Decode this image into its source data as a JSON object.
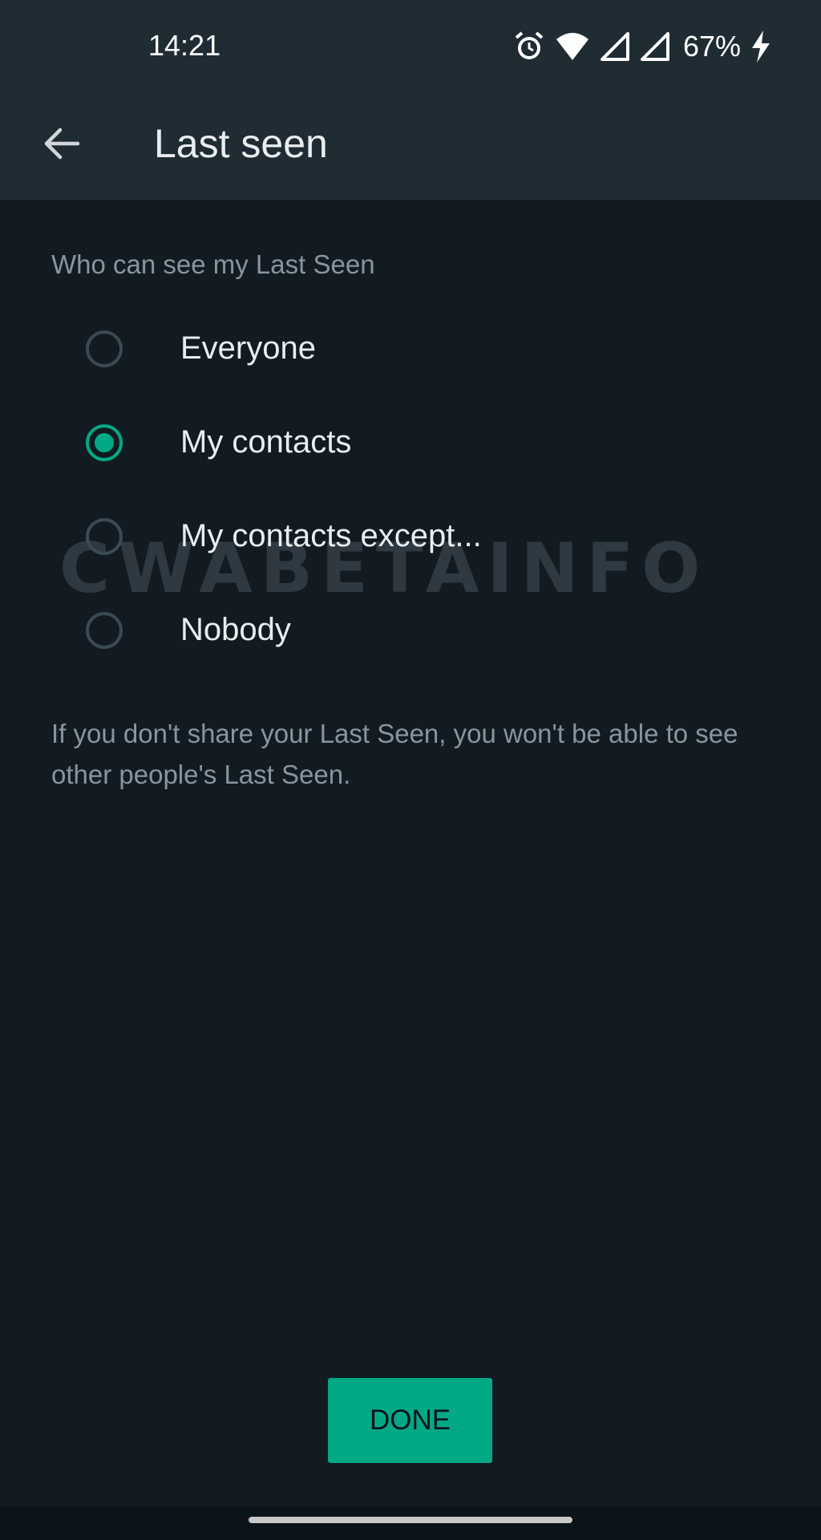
{
  "status_bar": {
    "time": "14:21",
    "battery": "67%",
    "icons": [
      "alarm-icon",
      "wifi-icon",
      "signal-icon",
      "signal-icon",
      "charging-bolt-icon"
    ]
  },
  "app_bar": {
    "back_icon": "arrow-left-icon",
    "title": "Last seen"
  },
  "section_header": "Who can see my Last Seen",
  "options": [
    {
      "label": "Everyone",
      "selected": false
    },
    {
      "label": "My contacts",
      "selected": true
    },
    {
      "label": "My contacts except...",
      "selected": false
    },
    {
      "label": "Nobody",
      "selected": false
    }
  ],
  "footnote": "If you don't share your Last Seen, you won't be able to see other people's Last Seen.",
  "watermark": "CWABETAINFO",
  "done_label": "DONE",
  "colors": {
    "accent": "#00a884",
    "background": "#121b22",
    "app_bar": "#1f2c34",
    "primary_text": "#e9edef",
    "secondary_text": "#8696a0"
  }
}
